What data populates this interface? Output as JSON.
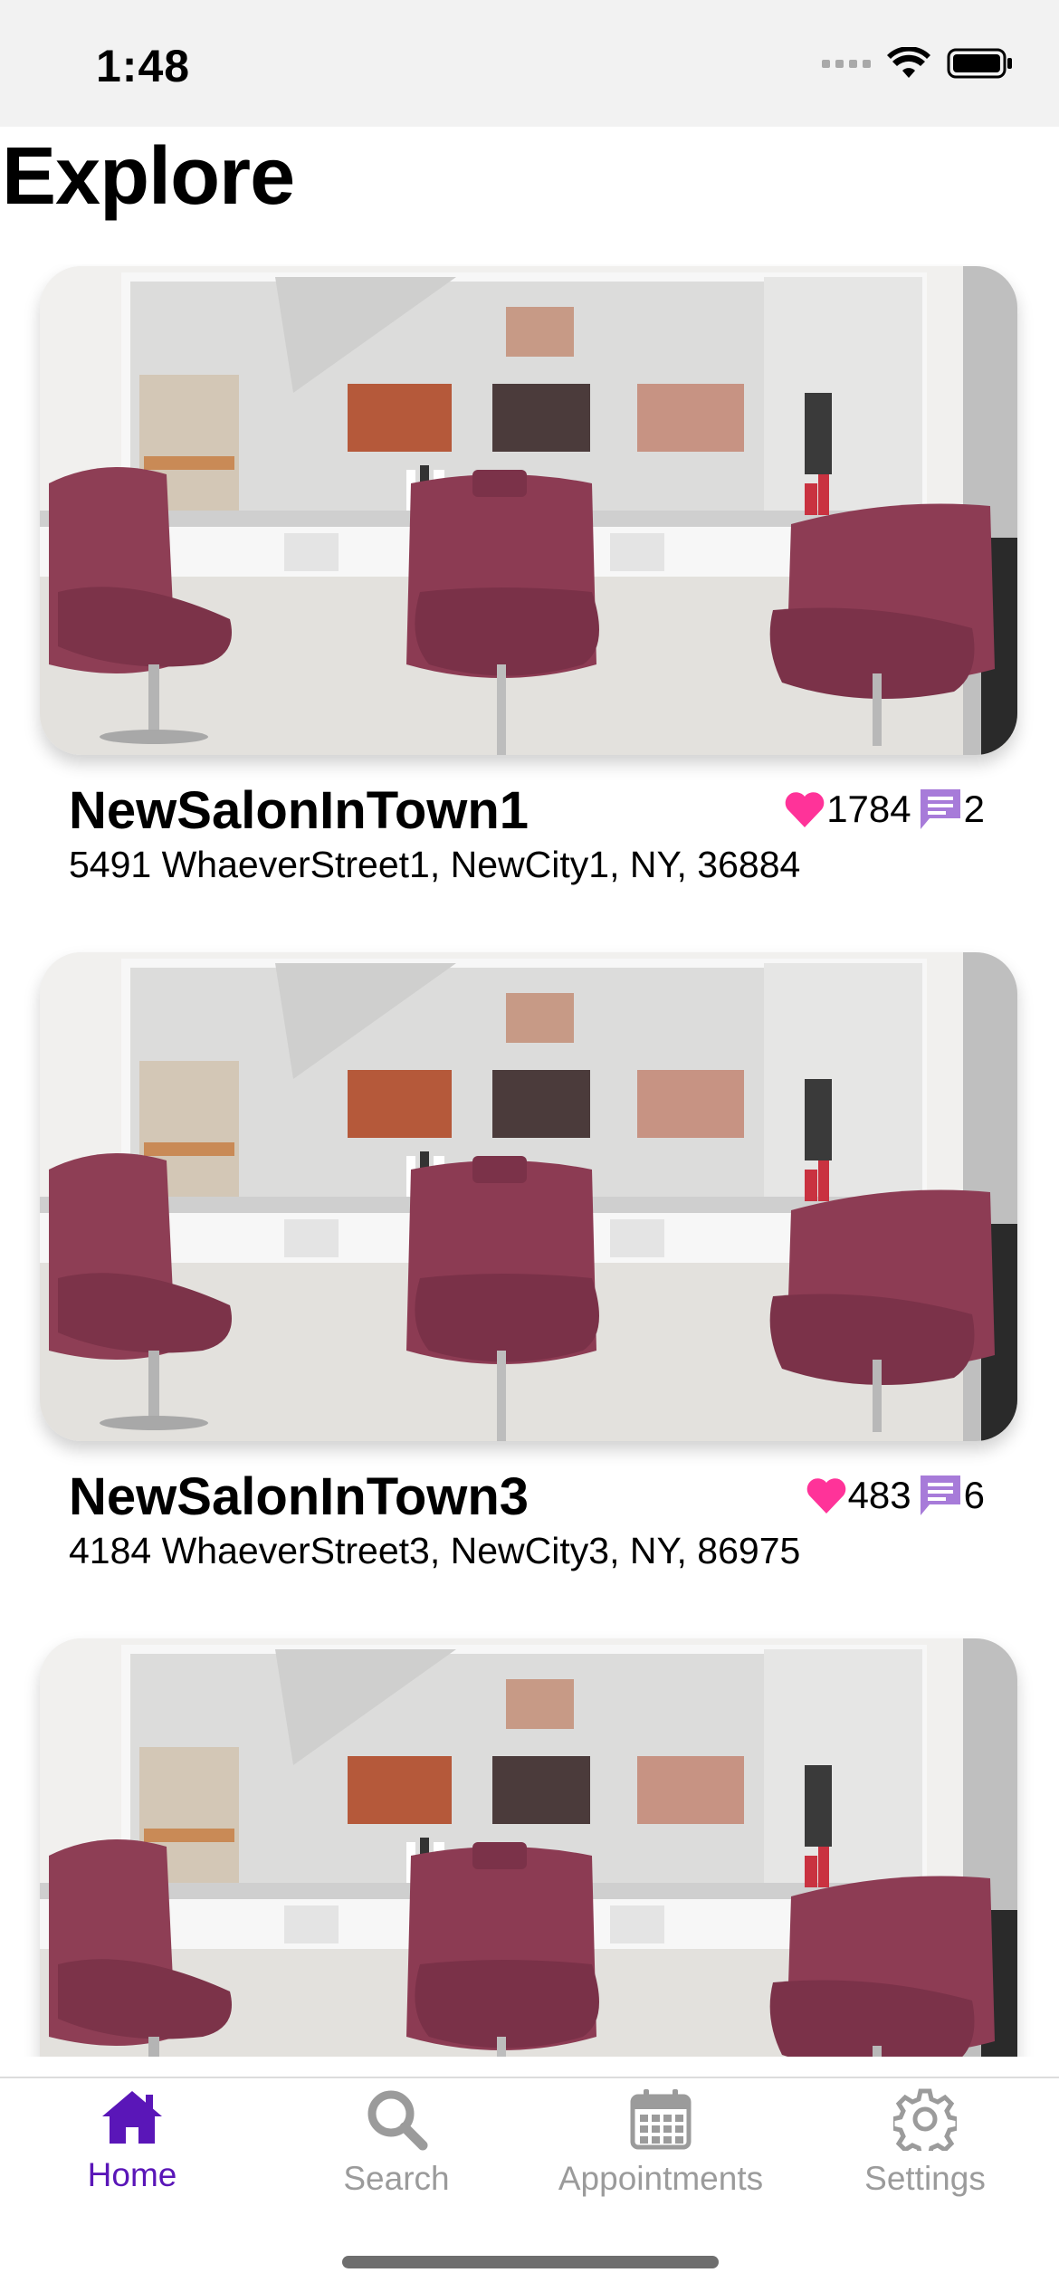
{
  "status": {
    "time": "1:48",
    "icons": [
      "cellular-signal-icon",
      "wifi-icon",
      "battery-icon"
    ]
  },
  "page": {
    "title": "Explore"
  },
  "salons": [
    {
      "name": "NewSalonInTown1",
      "address": "5491 WhaeverStreet1, NewCity1, NY, 36884",
      "likes": "1784",
      "comments": "2"
    },
    {
      "name": "NewSalonInTown3",
      "address": "4184 WhaeverStreet3, NewCity3, NY, 86975",
      "likes": "483",
      "comments": "6"
    },
    {
      "name": "",
      "address": "",
      "likes": "",
      "comments": ""
    }
  ],
  "tabs": [
    {
      "label": "Home",
      "icon": "home-icon",
      "active": true
    },
    {
      "label": "Search",
      "icon": "search-icon",
      "active": false
    },
    {
      "label": "Appointments",
      "icon": "calendar-icon",
      "active": false
    },
    {
      "label": "Settings",
      "icon": "gear-icon",
      "active": false
    }
  ],
  "colors": {
    "accent": "#5a16b8",
    "heart": "#ff3399",
    "comment": "#a77bd9",
    "tab_inactive": "#9b9b9b",
    "status_bar_bg": "#f2f2f2"
  }
}
